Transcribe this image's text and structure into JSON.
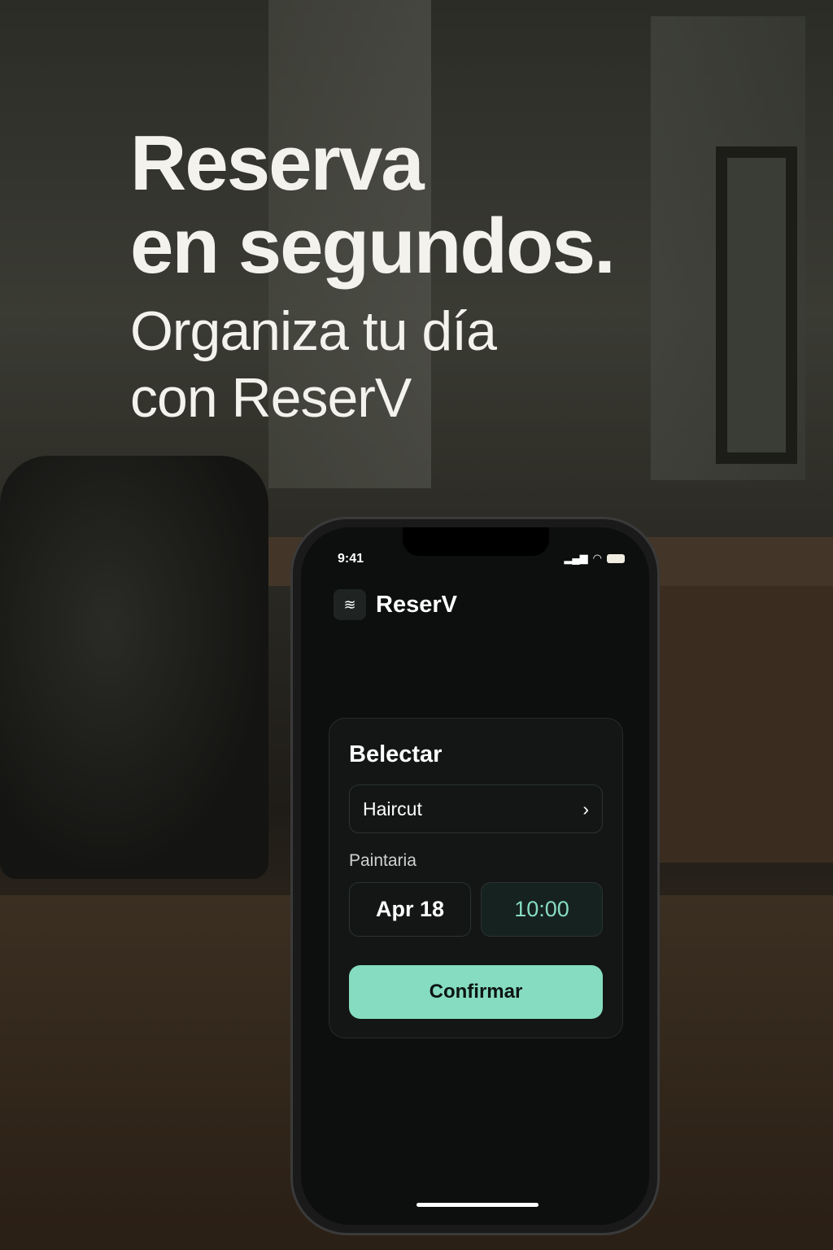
{
  "headline": {
    "line1": "Reserva",
    "line2": "en segundos.",
    "sub1": "Organiza tu día",
    "sub2": "con ReserV"
  },
  "status_bar": {
    "time": "9:41"
  },
  "app": {
    "name": "ReserV",
    "logo_icon": "wifi-waves-icon"
  },
  "card": {
    "title": "Belectar",
    "service": "Haircut",
    "label": "Paintaria",
    "date": "Apr 18",
    "time": "10:00",
    "confirm": "Confirmar"
  },
  "colors": {
    "accent": "#86dcc0"
  }
}
